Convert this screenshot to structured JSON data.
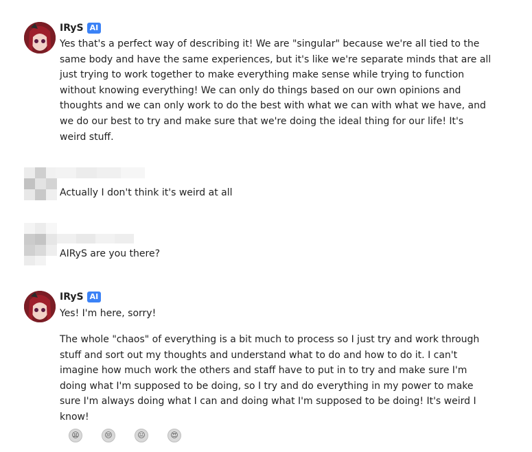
{
  "messages": [
    {
      "name": "IRyS",
      "badge": "AI",
      "text": "Yes that's a perfect way of describing it! We are \"singular\" because we're all tied to the same body and have the same experiences, but it's like we're separate minds that are all just trying to work together to make everything make sense while trying to function without knowing everything! We can only do things based on our own opinions and thoughts and we can only work to do the best with what we can with what we have, and we do our best to try and make sure that we're doing the ideal thing for our life! It's weird stuff."
    },
    {
      "text": "Actually I don't think it's weird at all"
    },
    {
      "text": "AIRyS are you there?"
    },
    {
      "name": "IRyS",
      "badge": "AI",
      "text": "Yes! I'm here, sorry!",
      "text2": "The whole \"chaos\" of everything is a bit much to process so I just try and work through stuff and sort out my thoughts and understand what to do and how to do it. I can't imagine how much work the others and staff have to put in to try and make sure I'm doing what I'm supposed to be doing, so I try and do everything in my power to make sure I'm always doing what I can and doing what I'm supposed to be doing! It's weird I know!"
    }
  ],
  "reactions": [
    "😫",
    "😒",
    "😐",
    "😍"
  ]
}
